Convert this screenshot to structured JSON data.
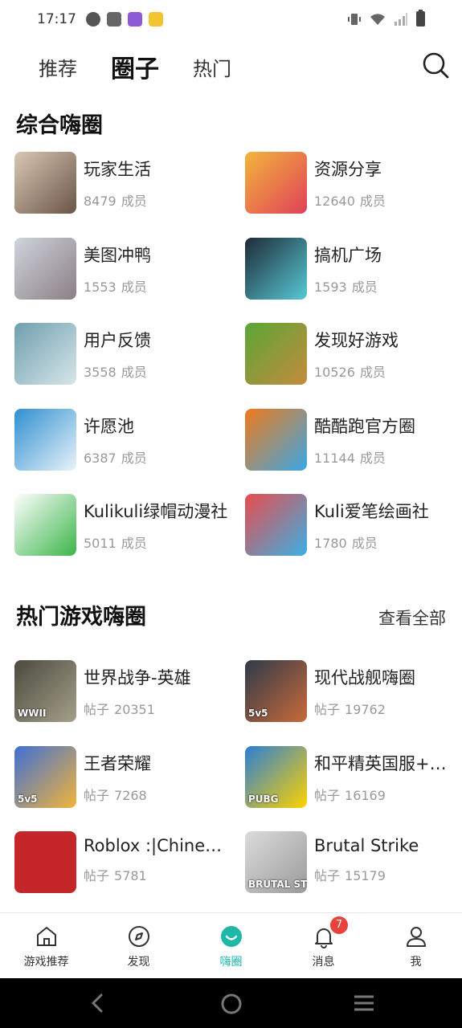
{
  "status": {
    "time": "17:17"
  },
  "tabs": [
    "推荐",
    "圈子",
    "热门"
  ],
  "sections": {
    "general": {
      "title": "综合嗨圈"
    },
    "games": {
      "title": "热门游戏嗨圈",
      "see_all": "查看全部"
    }
  },
  "general_circles": [
    {
      "name": "玩家生活",
      "count": "8479",
      "unit": "成员",
      "colors": [
        "#d9c7b5",
        "#6b5546"
      ]
    },
    {
      "name": "资源分享",
      "count": "12640",
      "unit": "成员",
      "colors": [
        "#f3b53a",
        "#e0405a"
      ]
    },
    {
      "name": "美图冲鸭",
      "count": "1553",
      "unit": "成员",
      "colors": [
        "#cfd4dc",
        "#8a7f84"
      ]
    },
    {
      "name": "搞机广场",
      "count": "1593",
      "unit": "成员",
      "colors": [
        "#1d2b36",
        "#58c9d6"
      ]
    },
    {
      "name": "用户反馈",
      "count": "3558",
      "unit": "成员",
      "colors": [
        "#6f9fae",
        "#d7e6ea"
      ]
    },
    {
      "name": "发现好游戏",
      "count": "10526",
      "unit": "成员",
      "colors": [
        "#5aa637",
        "#c58b3d"
      ]
    },
    {
      "name": "许愿池",
      "count": "6387",
      "unit": "成员",
      "colors": [
        "#2f8fd1",
        "#e9f3fa"
      ]
    },
    {
      "name": "酷酷跑官方圈",
      "count": "11144",
      "unit": "成员",
      "colors": [
        "#f07a1a",
        "#3aa7e6"
      ]
    },
    {
      "name": "Kulikuli绿帽动漫社",
      "count": "5011",
      "unit": "成员",
      "colors": [
        "#ffffff",
        "#3bb54a"
      ]
    },
    {
      "name": "Kuli爱笔绘画社",
      "count": "1780",
      "unit": "成员",
      "colors": [
        "#e84c4c",
        "#3ab0e6"
      ]
    }
  ],
  "game_circles": [
    {
      "name": "世界战争-英雄",
      "label": "帖子",
      "count": "20351",
      "colors": [
        "#4a4a3e",
        "#a5a08a"
      ],
      "overlay": "WWII"
    },
    {
      "name": "现代战舰嗨圈",
      "label": "帖子",
      "count": "19762",
      "colors": [
        "#2e3a4a",
        "#c96a3a"
      ],
      "overlay": "5v5"
    },
    {
      "name": "王者荣耀",
      "label": "帖子",
      "count": "7268",
      "colors": [
        "#3e70d6",
        "#f3b43a"
      ],
      "overlay": "5v5"
    },
    {
      "name": "和平精英国服+外服",
      "label": "帖子",
      "count": "16169",
      "colors": [
        "#2b7fd6",
        "#ffd200"
      ],
      "overlay": "PUBG"
    },
    {
      "name": "Roblox :|Chinese Ed",
      "label": "帖子",
      "count": "5781",
      "colors": [
        "#c4262a",
        "#c4262a"
      ],
      "overlay": ""
    },
    {
      "name": "Brutal Strike",
      "label": "帖子",
      "count": "15179",
      "colors": [
        "#dcdcdc",
        "#9a9a9a"
      ],
      "overlay": "BRUTAL STRIKE"
    }
  ],
  "bottom_nav": [
    {
      "label": "游戏推荐",
      "icon": "home-icon"
    },
    {
      "label": "发现",
      "icon": "compass-icon"
    },
    {
      "label": "嗨圈",
      "icon": "circle-smile-icon"
    },
    {
      "label": "消息",
      "icon": "bell-icon",
      "badge": "7"
    },
    {
      "label": "我",
      "icon": "user-icon"
    }
  ],
  "accent_color": "#1fb8a7"
}
